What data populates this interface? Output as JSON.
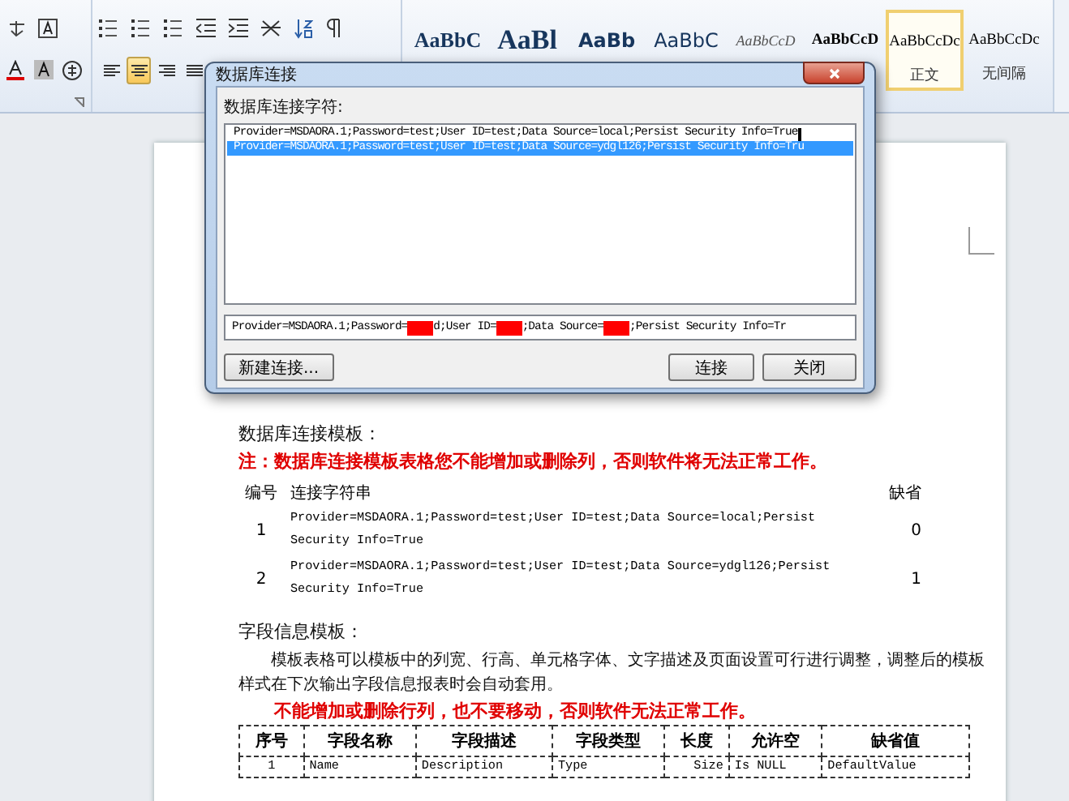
{
  "ribbon": {
    "alignment_buttons": [
      {
        "kind": "left",
        "selected": false
      },
      {
        "kind": "center",
        "selected": true
      },
      {
        "kind": "right",
        "selected": false
      },
      {
        "kind": "justify",
        "selected": false
      }
    ],
    "style_gallery": [
      {
        "kind": "heading1",
        "sample": "AaBbC",
        "selected": false
      },
      {
        "kind": "title",
        "sample": "AaBl",
        "selected": false
      },
      {
        "kind": "heading2",
        "sample": "AaBb",
        "selected": false
      },
      {
        "kind": "subtitle",
        "sample": "AaBbC",
        "selected": false
      },
      {
        "kind": "emphasis",
        "sample": "AaBbCcD",
        "selected": false
      },
      {
        "kind": "strong",
        "sample": "AaBbCcD",
        "selected": false
      },
      {
        "kind": "normal",
        "sample": "AaBbCcDc",
        "label": "正文",
        "selected": true
      },
      {
        "kind": "normal",
        "sample": "AaBbCcDc",
        "label": "无间隔",
        "selected": false
      }
    ]
  },
  "dialog": {
    "title": "数据库连接",
    "list_label": "数据库连接字符:",
    "connections": [
      {
        "text": "Provider=MSDAORA.1;Password=test;User ID=test;Data Source=local;Persist Security Info=True",
        "selected": false
      },
      {
        "text": "Provider=MSDAORA.1;Password=test;User ID=test;Data Source=ydgl126;Persist Security Info=Tru",
        "selected": true
      }
    ],
    "connection_field": {
      "parts": [
        "Provider=MSDAORA.1;Password=",
        "d;User ID=",
        ";Data Source=",
        ";Persist Security Info=Tr"
      ]
    },
    "buttons": [
      "新建连接...",
      "连接",
      "关闭"
    ]
  },
  "document": {
    "connection_template": {
      "heading": "数据库连接模板：",
      "note": "注：数据库连接模板表格您不能增加或删除列，否则软件将无法正常工作。",
      "columns": [
        "编号",
        "连接字符串",
        "缺省"
      ],
      "rows": [
        {
          "no": "1",
          "connection": "Provider=MSDAORA.1;Password=test;User ID=test;Data Source=local;Persist Security Info=True",
          "default": "0"
        },
        {
          "no": "2",
          "connection": "Provider=MSDAORA.1;Password=test;User ID=test;Data Source=ydgl126;Persist Security Info=True",
          "default": "1"
        }
      ]
    },
    "field_template": {
      "heading": "字段信息模板：",
      "description": "模板表格可以模板中的列宽、行高、单元格字体、文字描述及页面设置可行进行调整，调整后的模板样式在下次输出字段信息报表时会自动套用。",
      "warning": "不能增加或删除行列，也不要移动，否则软件无法正常工作。",
      "columns": [
        "序号",
        "字段名称",
        "字段描述",
        "字段类型",
        "长度",
        "允许空",
        "缺省值"
      ],
      "rows": [
        [
          "1",
          "Name",
          "Description",
          "Type",
          "Size",
          "Is NULL",
          "DefaultValue"
        ]
      ]
    }
  }
}
